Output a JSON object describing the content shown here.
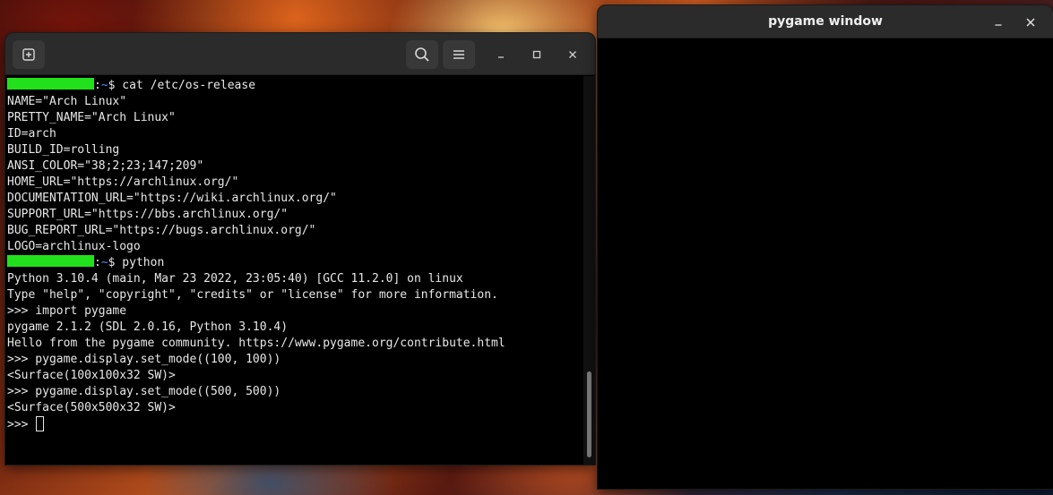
{
  "terminal": {
    "prompt_symbol": "$",
    "prompt_tilde": "~",
    "lines": [
      {
        "type": "prompt",
        "cmd": "cat /etc/os-release"
      },
      {
        "type": "out",
        "text": "NAME=\"Arch Linux\""
      },
      {
        "type": "out",
        "text": "PRETTY_NAME=\"Arch Linux\""
      },
      {
        "type": "out",
        "text": "ID=arch"
      },
      {
        "type": "out",
        "text": "BUILD_ID=rolling"
      },
      {
        "type": "out",
        "text": "ANSI_COLOR=\"38;2;23;147;209\""
      },
      {
        "type": "out",
        "text": "HOME_URL=\"https://archlinux.org/\""
      },
      {
        "type": "out",
        "text": "DOCUMENTATION_URL=\"https://wiki.archlinux.org/\""
      },
      {
        "type": "out",
        "text": "SUPPORT_URL=\"https://bbs.archlinux.org/\""
      },
      {
        "type": "out",
        "text": "BUG_REPORT_URL=\"https://bugs.archlinux.org/\""
      },
      {
        "type": "out",
        "text": "LOGO=archlinux-logo"
      },
      {
        "type": "prompt",
        "cmd": "python"
      },
      {
        "type": "out",
        "text": "Python 3.10.4 (main, Mar 23 2022, 23:05:40) [GCC 11.2.0] on linux"
      },
      {
        "type": "out",
        "text": "Type \"help\", \"copyright\", \"credits\" or \"license\" for more information."
      },
      {
        "type": "out",
        "text": ">>> import pygame"
      },
      {
        "type": "out",
        "text": "pygame 2.1.2 (SDL 2.0.16, Python 3.10.4)"
      },
      {
        "type": "out",
        "text": "Hello from the pygame community. https://www.pygame.org/contribute.html"
      },
      {
        "type": "out",
        "text": ">>> pygame.display.set_mode((100, 100))"
      },
      {
        "type": "out",
        "text": "<Surface(100x100x32 SW)>"
      },
      {
        "type": "out",
        "text": ">>> pygame.display.set_mode((500, 500))"
      },
      {
        "type": "out",
        "text": "<Surface(500x500x32 SW)>"
      },
      {
        "type": "input",
        "text": ">>> "
      }
    ]
  },
  "pygame_window": {
    "title": "pygame window"
  },
  "icons": {
    "new_tab": "new-tab-icon",
    "search": "search-icon",
    "menu": "hamburger-menu-icon",
    "minimize": "minimize-icon",
    "maximize": "maximize-icon",
    "close": "close-icon"
  },
  "colors": {
    "prompt_user": "#22e11c",
    "tilde": "#4f8cff",
    "terminal_bg": "#000000",
    "header_bg": "#2b2b2b",
    "text": "#e8e8e8"
  }
}
